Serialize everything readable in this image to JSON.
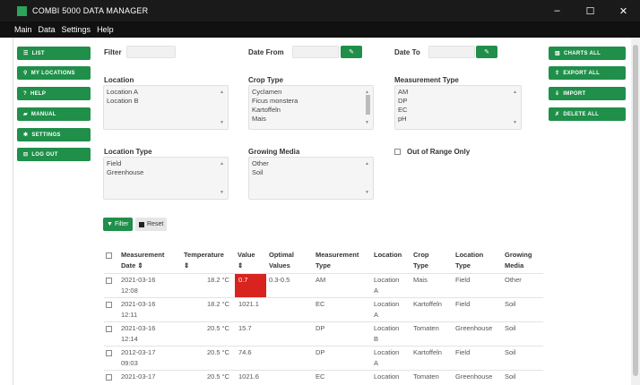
{
  "window": {
    "title": "COMBI 5000 DATA MANAGER",
    "controls": [
      "–",
      "☐",
      "✕"
    ]
  },
  "menu": [
    "Main",
    "Data",
    "Settings",
    "Help"
  ],
  "sidebar": [
    {
      "label": "LIST",
      "icon": "list-icon",
      "glyph": "☰"
    },
    {
      "label": "MY LOCATIONS",
      "icon": "location-pin-icon",
      "glyph": "⚲"
    },
    {
      "label": "HELP",
      "icon": "question-icon",
      "glyph": "?"
    },
    {
      "label": "MANUAL",
      "icon": "book-icon",
      "glyph": "▰"
    },
    {
      "label": "SETTINGS",
      "icon": "gear-icon",
      "glyph": "✱"
    },
    {
      "label": "LOG OUT",
      "icon": "logout-icon",
      "glyph": "⊟"
    }
  ],
  "actions": [
    {
      "label": "CHARTS ALL",
      "icon": "chart-icon",
      "glyph": "▥"
    },
    {
      "label": "EXPORT ALL",
      "icon": "export-icon",
      "glyph": "⇪"
    },
    {
      "label": "IMPORT",
      "icon": "import-icon",
      "glyph": "⇩"
    },
    {
      "label": "DELETE ALL",
      "icon": "trash-icon",
      "glyph": "✗"
    }
  ],
  "filters": {
    "filter_label": "Filter",
    "date_from_label": "Date From",
    "date_to_label": "Date To",
    "location_label": "Location",
    "locations": [
      "Location A",
      "Location B"
    ],
    "crop_type_label": "Crop Type",
    "crop_types": [
      "Cyclamen",
      "Ficus monstera",
      "Kartoffeln",
      "Mais"
    ],
    "measurement_type_label": "Measurement Type",
    "measurement_types": [
      "AM",
      "DP",
      "EC",
      "pH"
    ],
    "location_type_label": "Location Type",
    "location_types": [
      "Field",
      "Greenhouse"
    ],
    "growing_media_label": "Growing Media",
    "growing_media": [
      "Other",
      "Soil"
    ],
    "out_of_range_label": "Out of Range Only",
    "filter_button": "Filter",
    "reset_button": "Reset"
  },
  "table": {
    "headers": [
      [
        "Measurement",
        "Date ⇕"
      ],
      [
        "Temperature",
        "⇕"
      ],
      [
        "Value",
        "⇕"
      ],
      [
        "Optimal",
        "Values"
      ],
      [
        "Measurement",
        "Type"
      ],
      [
        "Location",
        ""
      ],
      [
        "Crop",
        "Type"
      ],
      [
        "Location",
        "Type"
      ],
      [
        "Growing",
        "Media"
      ]
    ],
    "rows": [
      {
        "date": [
          "2021-03-16",
          "12:08"
        ],
        "temp": "18.2 °C",
        "value": "0.7",
        "optimal": "0.3-0.5",
        "mtype": "AM",
        "location": [
          "Location",
          "A"
        ],
        "crop": "Mais",
        "ltype": "Field",
        "media": "Other",
        "out_of_range": true
      },
      {
        "date": [
          "2021-03-16",
          "12:11"
        ],
        "temp": "18.2 °C",
        "value": "1021.1",
        "optimal": "",
        "mtype": "EC",
        "location": [
          "Location",
          "A"
        ],
        "crop": "Kartoffeln",
        "ltype": "Field",
        "media": "Soil",
        "out_of_range": false
      },
      {
        "date": [
          "2021-03-16",
          "12:14"
        ],
        "temp": "20.5 °C",
        "value": "15.7",
        "optimal": "",
        "mtype": "DP",
        "location": [
          "Location",
          "B"
        ],
        "crop": "Tomaten",
        "ltype": "Greenhouse",
        "media": "Soil",
        "out_of_range": false
      },
      {
        "date": [
          "2012-03-17",
          "09:03"
        ],
        "temp": "20.5 °C",
        "value": "74.6",
        "optimal": "",
        "mtype": "DP",
        "location": [
          "Location",
          "A"
        ],
        "crop": "Kartoffeln",
        "ltype": "Field",
        "media": "Soil",
        "out_of_range": false
      },
      {
        "date": [
          "2021-03-17",
          ""
        ],
        "temp": "20.5 °C",
        "value": "1021.6",
        "optimal": "",
        "mtype": "EC",
        "location": [
          "Location",
          ""
        ],
        "crop": "Tomaten",
        "ltype": "Greenhouse",
        "media": "Soil",
        "out_of_range": false
      }
    ]
  },
  "colors": {
    "accent": "#1f8f4a",
    "alert": "#d9231e",
    "titlebar": "#1a1a1a"
  }
}
